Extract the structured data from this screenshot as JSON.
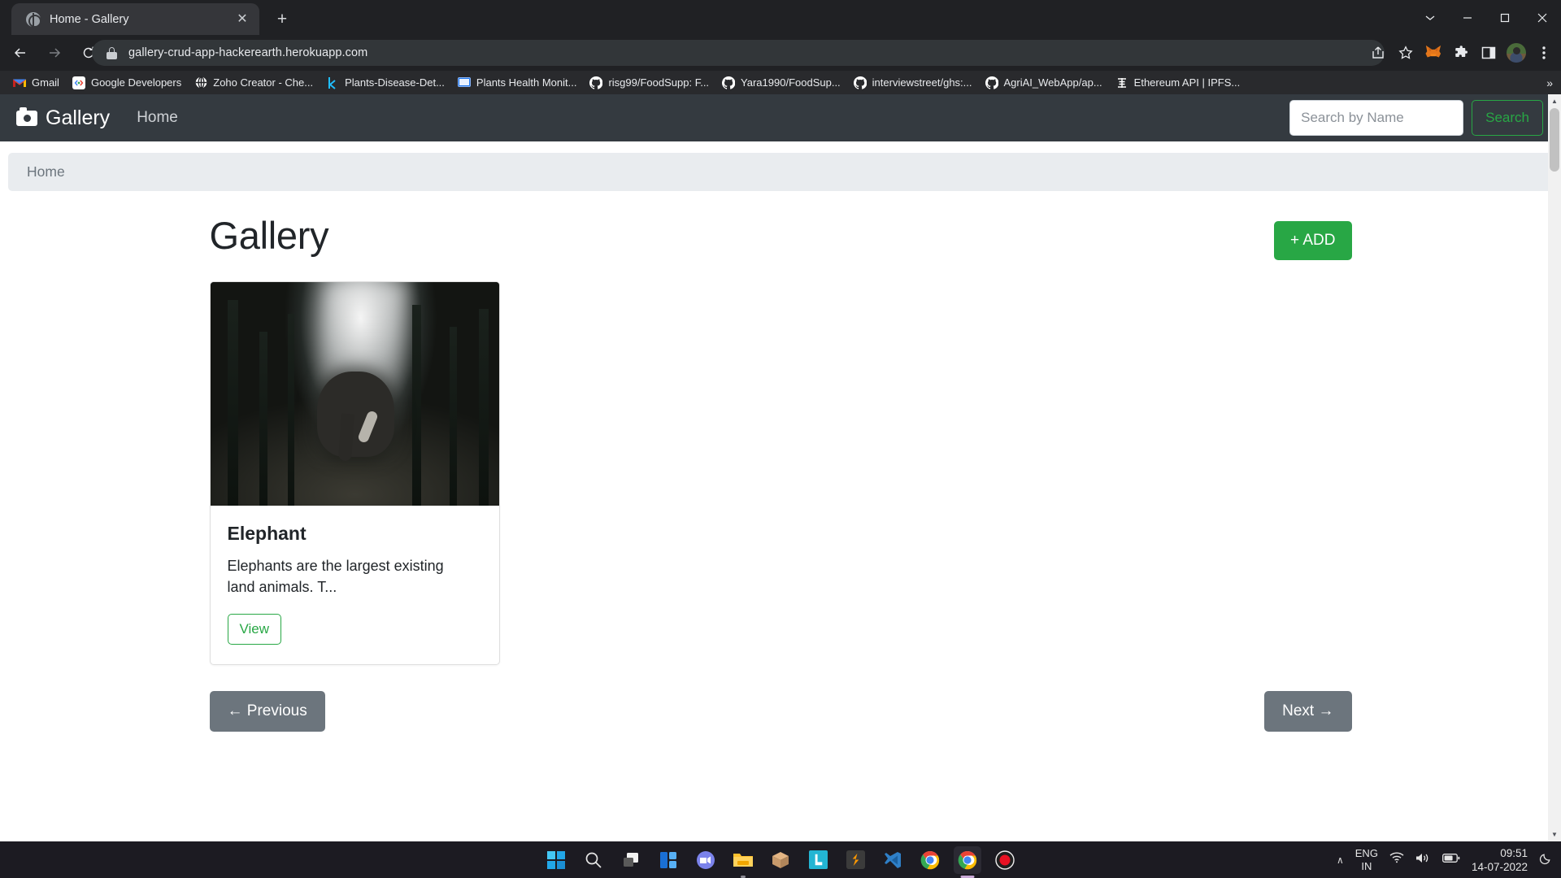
{
  "browser": {
    "tab": {
      "title": "Home - Gallery",
      "favicon": "globe-icon",
      "close": "✕"
    },
    "new_tab": "+",
    "window_controls": {
      "minimize_group": "⌄",
      "minimize": "─",
      "maximize": "☐",
      "close": "✕"
    },
    "nav": {
      "back": "←",
      "forward": "→",
      "reload": "↻"
    },
    "omnibox": {
      "url": "gallery-crud-app-hackerearth.herokuapp.com",
      "lock": "lock-icon"
    },
    "toolbar_icons": [
      "share-icon",
      "star-icon",
      "metamask-fox-icon",
      "extensions-puzzle-icon",
      "sidepanel-icon",
      "profile-avatar",
      "kebab-menu-icon"
    ],
    "bookmarks": [
      {
        "label": "Gmail",
        "icon": "gmail-icon"
      },
      {
        "label": "Google Developers",
        "icon": "google-developers-icon"
      },
      {
        "label": "Zoho Creator - Che...",
        "icon": "globe-icon"
      },
      {
        "label": "Plants-Disease-Det...",
        "icon": "kaggle-icon"
      },
      {
        "label": "Plants Health Monit...",
        "icon": "screen-icon"
      },
      {
        "label": "risg99/FoodSupp: F...",
        "icon": "github-icon"
      },
      {
        "label": "Yara1990/FoodSup...",
        "icon": "github-icon"
      },
      {
        "label": "interviewstreet/ghs:...",
        "icon": "github-icon"
      },
      {
        "label": "AgriAI_WebApp/ap...",
        "icon": "github-icon"
      },
      {
        "label": "Ethereum API | IPFS...",
        "icon": "infura-icon"
      }
    ],
    "bookmarks_overflow": "»"
  },
  "site": {
    "navbar": {
      "brand": "Gallery",
      "brand_icon": "camera-icon",
      "links": [
        {
          "label": "Home"
        }
      ],
      "search": {
        "placeholder": "Search by Name",
        "value": "",
        "button": "Search"
      }
    },
    "breadcrumb": [
      {
        "label": "Home"
      }
    ],
    "main": {
      "title": "Gallery",
      "add_button": "+ ADD",
      "cards": [
        {
          "image_alt": "elephant-in-forest-photo",
          "title": "Elephant",
          "text": "Elephants are the largest existing land animals. T...",
          "view_button": "View"
        }
      ],
      "pagination": {
        "previous": "← Previous",
        "next": "Next →"
      }
    },
    "colors": {
      "navbar_bg": "#343a40",
      "success": "#28a745",
      "breadcrumb_bg": "#e9ecef",
      "secondary": "#6c757d"
    }
  },
  "taskbar": {
    "apps": [
      {
        "name": "start-windows-icon"
      },
      {
        "name": "search-icon"
      },
      {
        "name": "task-view-icon"
      },
      {
        "name": "widgets-icon"
      },
      {
        "name": "microsoft-teams-icon"
      },
      {
        "name": "file-explorer-icon"
      },
      {
        "name": "box-package-icon"
      },
      {
        "name": "lumion-icon"
      },
      {
        "name": "sublime-text-icon"
      },
      {
        "name": "visual-studio-code-icon"
      },
      {
        "name": "google-chrome-icon"
      },
      {
        "name": "google-chrome-active-icon"
      },
      {
        "name": "screen-recorder-icon"
      }
    ],
    "tray": {
      "overflow": "∧",
      "language": {
        "line1": "ENG",
        "line2": "IN"
      },
      "icons": [
        "wifi-icon",
        "volume-icon",
        "battery-icon"
      ],
      "time": "09:51",
      "date": "14-07-2022",
      "notification": "moon-icon"
    }
  }
}
